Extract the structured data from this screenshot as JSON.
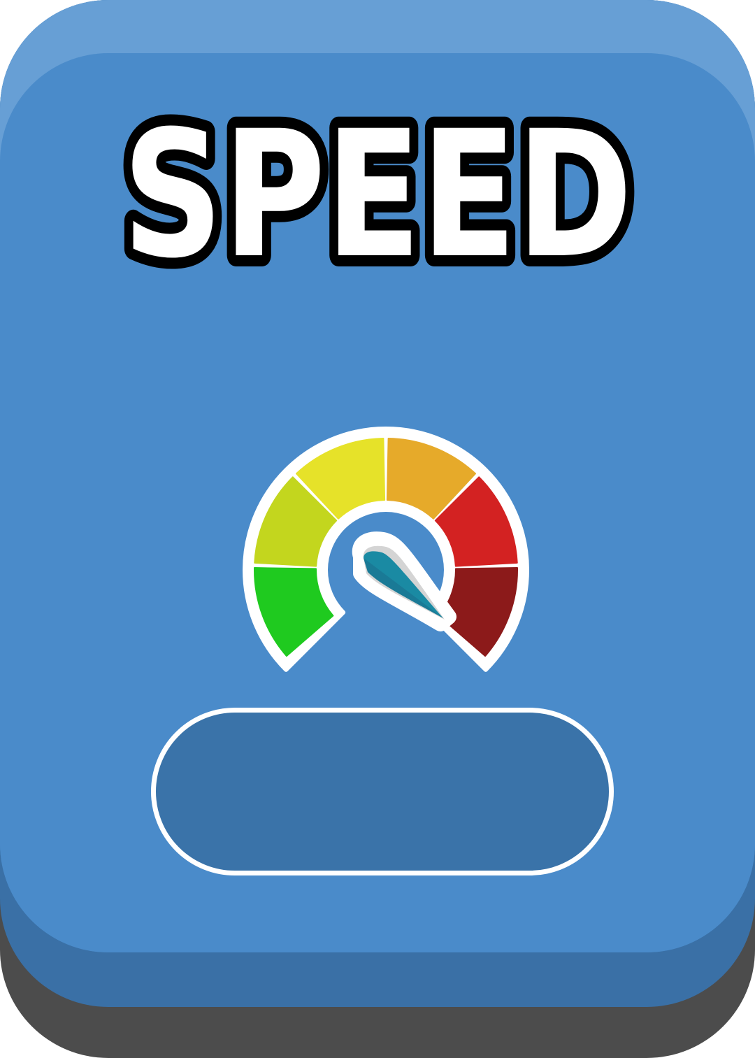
{
  "card": {
    "title": "SPEED",
    "value_text": ""
  },
  "colors": {
    "card_face": "#4a8bca",
    "card_edge": "#3a70a6",
    "card_shadow": "#4c4c4c",
    "pill_fill": "#3a73a9",
    "title_fill": "#ffffff",
    "title_outline": "#000000"
  },
  "gauge": {
    "icon": "speedometer-icon",
    "segment_colors": [
      "#1fca1f",
      "#c3d61e",
      "#e6e229",
      "#e6aa2a",
      "#d32222",
      "#8c1a1a"
    ],
    "needle_color": "#1a8aa3"
  }
}
